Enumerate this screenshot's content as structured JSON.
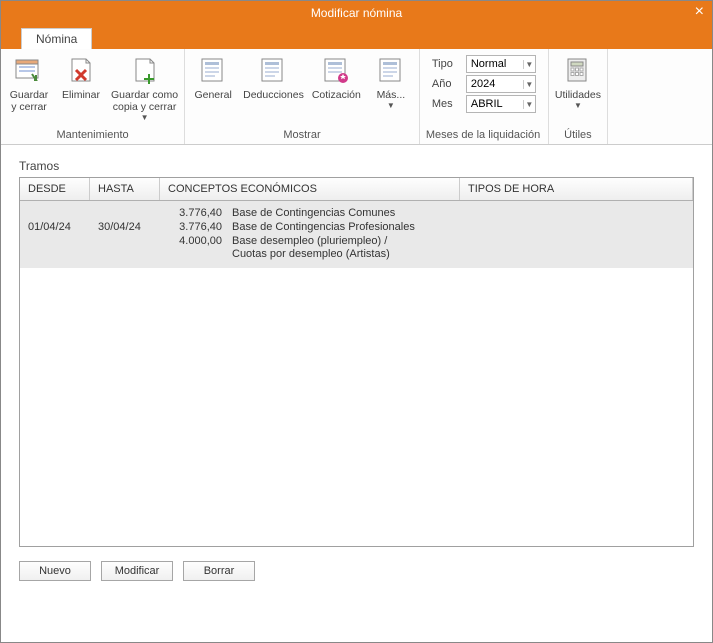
{
  "window": {
    "title": "Modificar nómina"
  },
  "tab": {
    "label": "Nómina"
  },
  "ribbon": {
    "mantenimiento": {
      "label": "Mantenimiento",
      "guardar_cerrar": "Guardar\ny cerrar",
      "eliminar": "Eliminar",
      "guardar_como": "Guardar como\ncopia y cerrar"
    },
    "mostrar": {
      "label": "Mostrar",
      "general": "General",
      "deducciones": "Deducciones",
      "cotizacion": "Cotización",
      "mas": "Más..."
    },
    "meses": {
      "label": "Meses de la liquidación",
      "tipo_label": "Tipo",
      "tipo_value": "Normal",
      "ano_label": "Año",
      "ano_value": "2024",
      "mes_label": "Mes",
      "mes_value": "ABRIL"
    },
    "utiles": {
      "label": "Útiles",
      "utilidades": "Utilidades"
    }
  },
  "section": {
    "title": "Tramos"
  },
  "grid": {
    "headers": {
      "desde": "DESDE",
      "hasta": "HASTA",
      "conceptos": "CONCEPTOS ECONÓMICOS",
      "tipos": "TIPOS DE HORA"
    },
    "row": {
      "desde": "01/04/24",
      "hasta": "30/04/24",
      "conc_lines": [
        {
          "amt": "3.776,40",
          "txt": "Base de Contingencias Comunes"
        },
        {
          "amt": "3.776,40",
          "txt": "Base de Contingencias Profesionales"
        },
        {
          "amt": "4.000,00",
          "txt": "Base desempleo (pluriempleo) /"
        },
        {
          "amt": "",
          "txt": "Cuotas por desempleo (Artistas)"
        }
      ],
      "tipos": ""
    }
  },
  "buttons": {
    "nuevo": "Nuevo",
    "modificar": "Modificar",
    "borrar": "Borrar"
  }
}
